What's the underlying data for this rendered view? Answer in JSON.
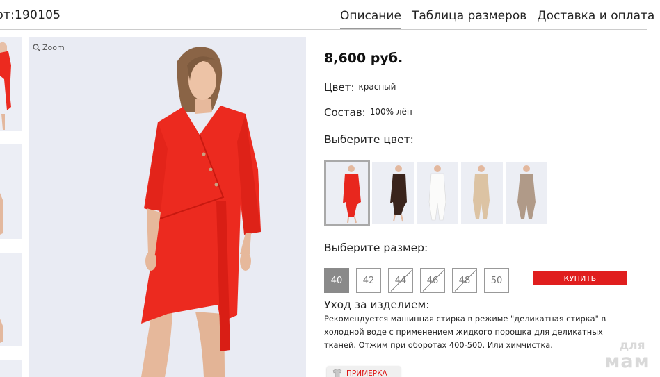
{
  "product": {
    "article": "рт:190105",
    "price": "8,600 руб.",
    "color_label": "Цвет:",
    "color_value": "красный",
    "composition_label": "Состав:",
    "composition_value": "100% лён"
  },
  "tabs": [
    {
      "label": "Описание",
      "active": true
    },
    {
      "label": "Таблица размеров",
      "active": false
    },
    {
      "label": "Доставка и оплата",
      "active": false
    }
  ],
  "gallery": {
    "zoom_label": "Zoom"
  },
  "color_select": {
    "title": "Выберите цвет:",
    "options": [
      {
        "name": "red",
        "color": "#e8271e",
        "selected": true
      },
      {
        "name": "dark-brown",
        "color": "#3a241c",
        "selected": false
      },
      {
        "name": "white",
        "color": "#f7f7f5",
        "selected": false
      },
      {
        "name": "beige",
        "color": "#dcc3a3",
        "selected": false
      },
      {
        "name": "taupe",
        "color": "#b09a88",
        "selected": false
      }
    ]
  },
  "size_select": {
    "title": "Выберите размер:",
    "sizes": [
      {
        "label": "40",
        "state": "selected"
      },
      {
        "label": "42",
        "state": "available"
      },
      {
        "label": "44",
        "state": "unavailable"
      },
      {
        "label": "46",
        "state": "unavailable"
      },
      {
        "label": "48",
        "state": "unavailable"
      },
      {
        "label": "50",
        "state": "available"
      }
    ]
  },
  "buy_button": "КУПИТЬ",
  "care": {
    "title": "Уход за изделием:",
    "text": "Рекомендуется машинная стирка в режиме \"деликатная стирка\" в холодной воде с применением жидкого порошка для деликатных тканей. Отжим при оборотах 400-500. Или химчистка."
  },
  "fitting_button": "ПРИМЕРКА",
  "watermark": {
    "line1": "для",
    "line2": "мам"
  },
  "colors": {
    "accent": "#e01e1e",
    "dress": "#ec2a1f",
    "photo_bg": "#e9ebf3"
  }
}
